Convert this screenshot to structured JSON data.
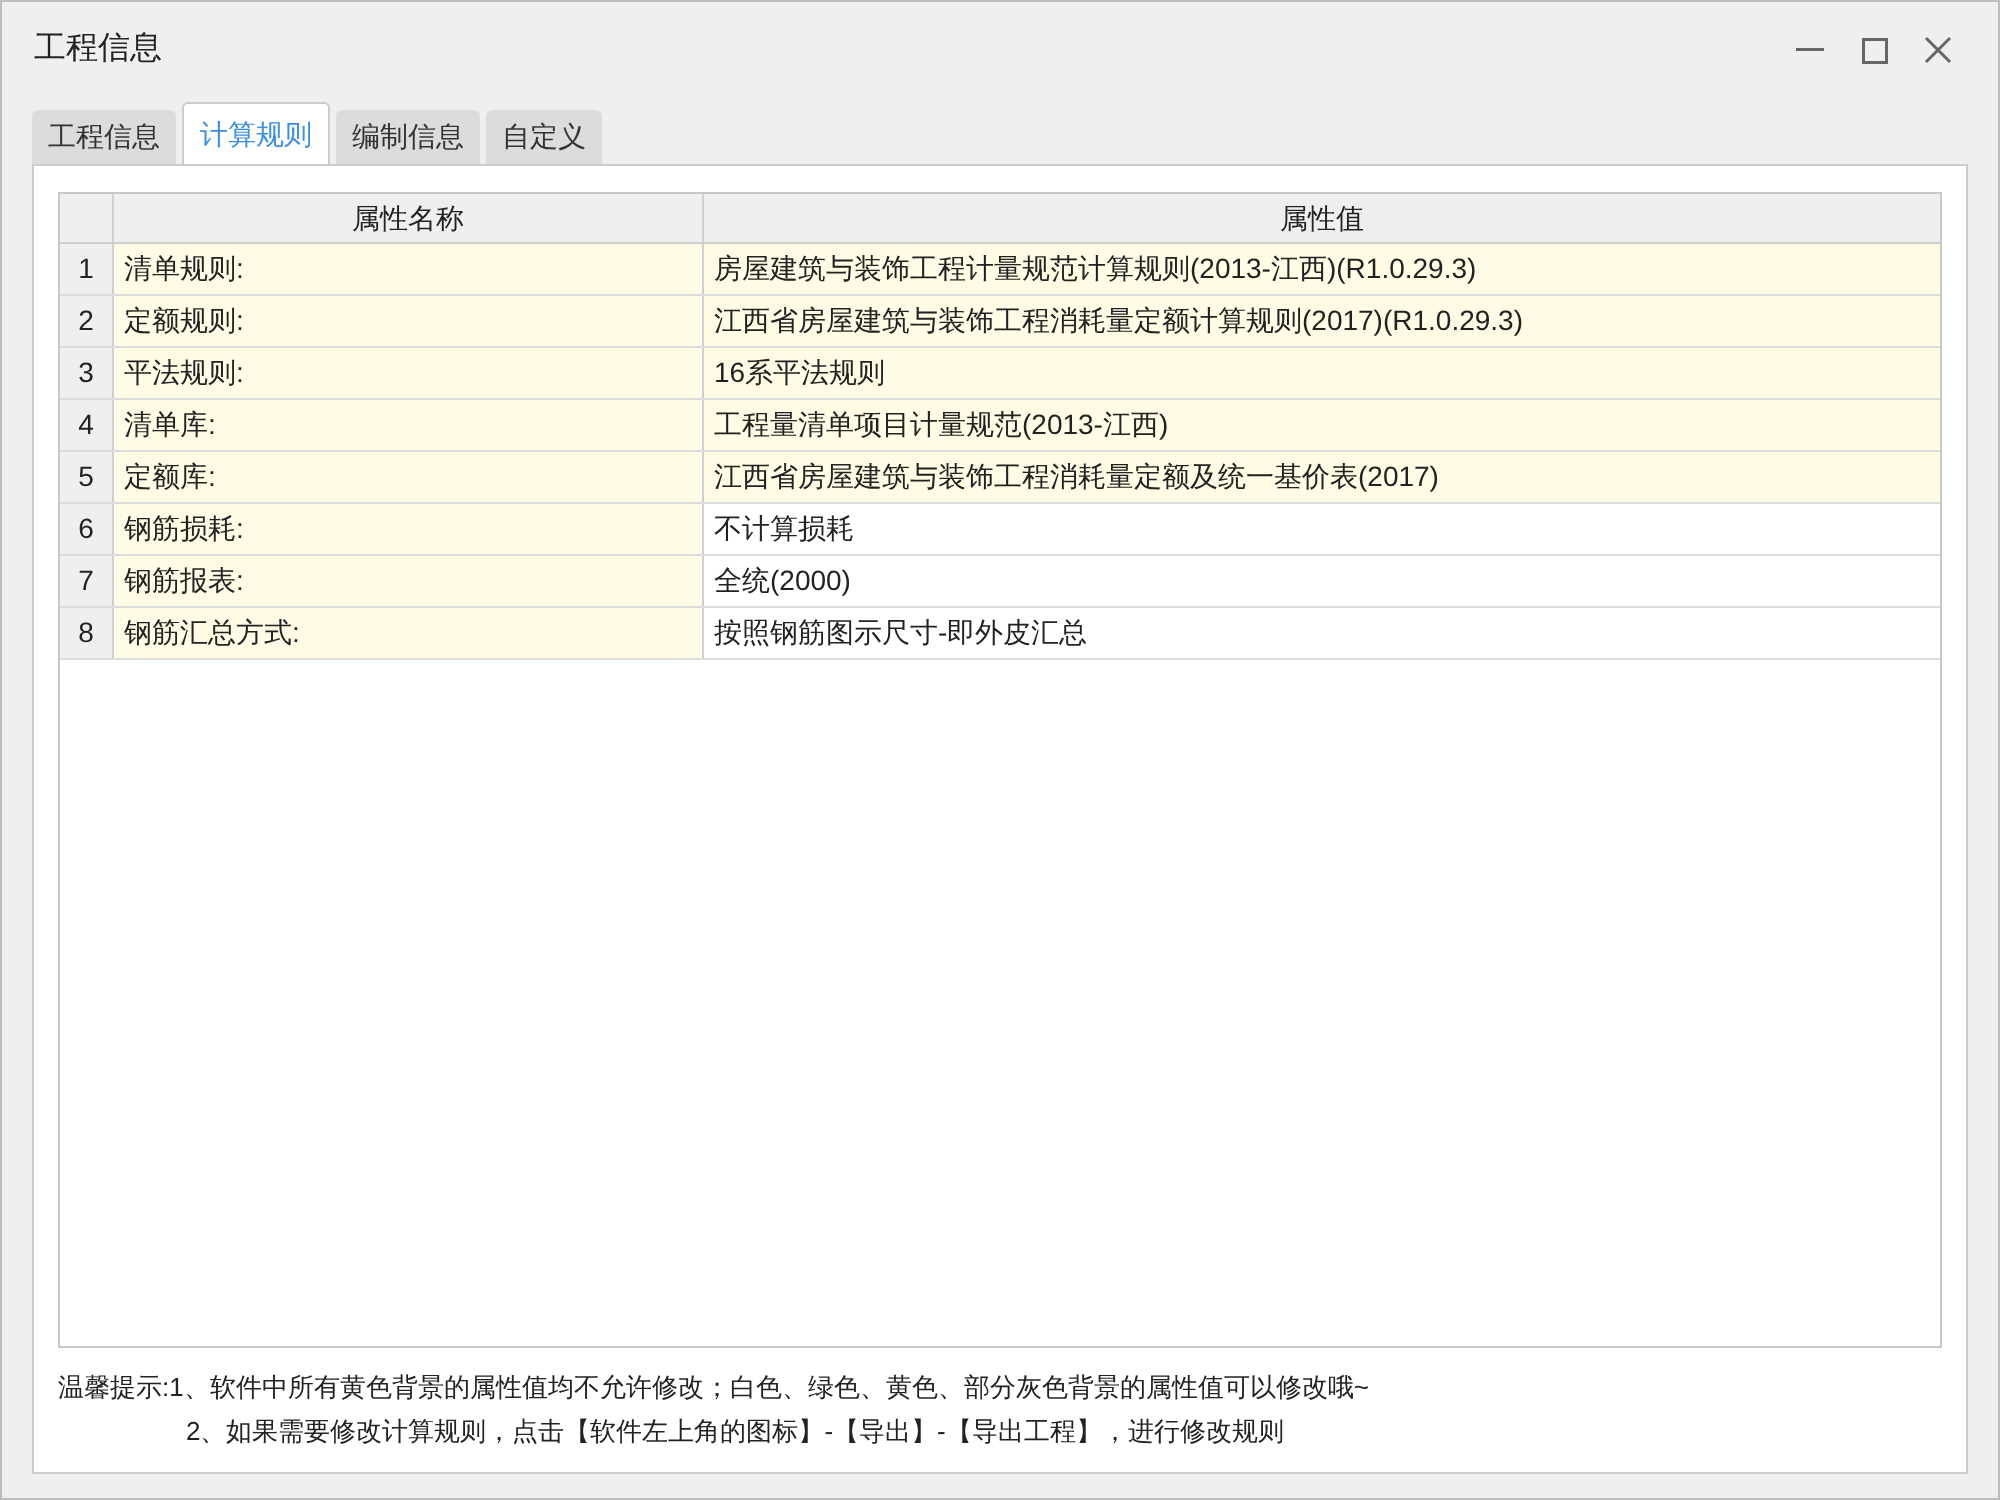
{
  "window": {
    "title": "工程信息"
  },
  "tabs": [
    {
      "label": "工程信息",
      "selected": false
    },
    {
      "label": "计算规则",
      "selected": true
    },
    {
      "label": "编制信息",
      "selected": false
    },
    {
      "label": "自定义",
      "selected": false
    }
  ],
  "table": {
    "columns": [
      "属性名称",
      "属性值"
    ],
    "rows": [
      {
        "index": "1",
        "name": "清单规则:",
        "value": "房屋建筑与装饰工程计量规范计算规则(2013-江西)(R1.0.29.3)",
        "locked": true
      },
      {
        "index": "2",
        "name": "定额规则:",
        "value": "江西省房屋建筑与装饰工程消耗量定额计算规则(2017)(R1.0.29.3)",
        "locked": true
      },
      {
        "index": "3",
        "name": "平法规则:",
        "value": "16系平法规则",
        "locked": true
      },
      {
        "index": "4",
        "name": "清单库:",
        "value": "工程量清单项目计量规范(2013-江西)",
        "locked": true
      },
      {
        "index": "5",
        "name": "定额库:",
        "value": "江西省房屋建筑与装饰工程消耗量定额及统一基价表(2017)",
        "locked": true
      },
      {
        "index": "6",
        "name": "钢筋损耗:",
        "value": "不计算损耗",
        "locked": false
      },
      {
        "index": "7",
        "name": "钢筋报表:",
        "value": "全统(2000)",
        "locked": false
      },
      {
        "index": "8",
        "name": "钢筋汇总方式:",
        "value": "按照钢筋图示尺寸-即外皮汇总",
        "locked": false
      }
    ]
  },
  "tips": [
    "温馨提示:1、软件中所有黄色背景的属性值均不允许修改；白色、绿色、黄色、部分灰色背景的属性值可以修改哦~",
    "2、如果需要修改计算规则，点击【软件左上角的图标】-【导出】-【导出工程】，进行修改规则"
  ]
}
